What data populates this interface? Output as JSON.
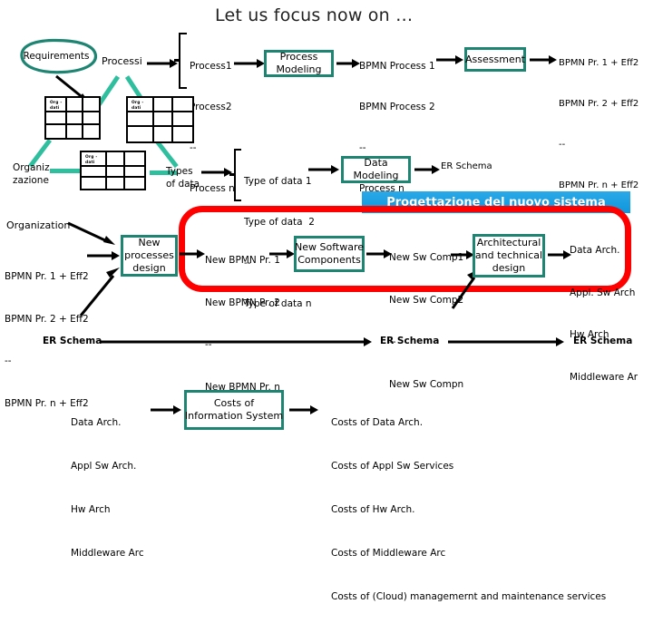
{
  "slide": {
    "title": "Let us focus now on …",
    "banner": "Progettazione del nuovo sistema",
    "accent_teal": "#1E8573",
    "accent_line_teal": "#2FBF9F",
    "accent_red": "#FF0000",
    "accent_blue": "#0E96DC"
  },
  "row1": {
    "requirements": "Requirements",
    "processi": "Processi",
    "process_list": [
      "Process1",
      "Process2",
      "--",
      "Process n"
    ],
    "process_modeling": "Process\nModeling",
    "bpmn_list": [
      "BPMN Process 1",
      "BPMN Process 2",
      "--",
      "Process n"
    ],
    "assessment": "Assessment",
    "bpmn_eff_list": [
      "BPMN Pr. 1 + Eff2",
      "BPMN Pr. 2 + Eff2",
      "--",
      "BPMN Pr. n + Eff2"
    ]
  },
  "tables": {
    "header_text": "Org -\ndati",
    "count": 3
  },
  "row2": {
    "organizzazione": "Organiz\nzazione",
    "types_of_data": "Types\nof data",
    "type_list": [
      "Type of data 1",
      "Type of data  2",
      "--",
      "Type of data n"
    ],
    "data_modeling": "Data\nModeling",
    "er_schema": "ER Schema"
  },
  "row3": {
    "organization": "Organization",
    "bpmn_eff_list": [
      "BPMN Pr. 1 + Eff2",
      "BPMN Pr. 2 + Eff2",
      "--",
      "BPMN Pr. n + Eff2"
    ],
    "new_processes_design": "New\nprocesses\ndesign",
    "new_bpmn_list": [
      "New BPMN Pr. 1",
      "New BPMN Pr. 2",
      "--",
      "New BPMN Pr. n"
    ],
    "new_software_components": "New Software\nComponents",
    "new_sw_comp_list": [
      "New Sw Comp1",
      "New Sw Comp2",
      "--",
      "New Sw Compn"
    ],
    "architectural_design": "Architectural\nand technical\ndesign",
    "arch_output_list": [
      "Data Arch.",
      "Appl. Sw Arch",
      "Hw Arch",
      "Middleware Ar"
    ]
  },
  "row4": {
    "er_schema_left": "ER Schema",
    "er_schema_mid": "ER Schema",
    "er_schema_right": "ER Schema"
  },
  "row5": {
    "arch_input_list": [
      "Data Arch.",
      "Appl Sw Arch.",
      "Hw Arch",
      "Middleware Arc"
    ],
    "costs_box": "Costs of\nInformation System",
    "costs_list": [
      "Costs of Data Arch.",
      "Costs of Appl Sw Services",
      "Costs of Hw Arch.",
      "Costs of Middleware Arc",
      "Costs of (Cloud) managemernt and maintenance services"
    ]
  }
}
